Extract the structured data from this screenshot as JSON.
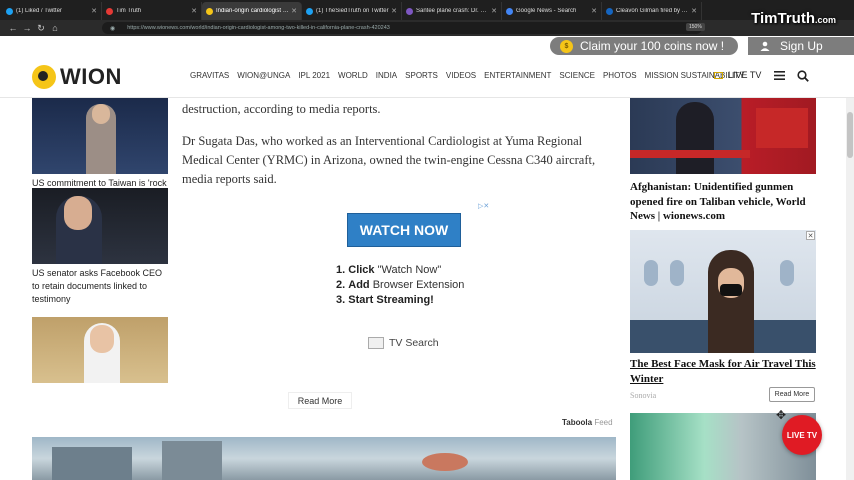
{
  "browser": {
    "tabs": [
      {
        "label": "(1) Liked / Twitter",
        "color": "#1da1f2",
        "active": false
      },
      {
        "label": "Tim Truth",
        "color": "#e53935",
        "active": false
      },
      {
        "label": "Indian-origin cardiologist amo",
        "color": "#f5c518",
        "active": true
      },
      {
        "label": "(1) TheSiedTruth on Twitter",
        "color": "#1da1f2",
        "active": false
      },
      {
        "label": "Santee plane crash: Dr. Sugata",
        "color": "#7e57c2",
        "active": false
      },
      {
        "label": "Google News - Search",
        "color": "#4285f4",
        "active": false
      },
      {
        "label": "Cleavon Gilman fired by Yuma",
        "color": "#1565c0",
        "active": false
      }
    ],
    "url": "https://www.wionews.com/world/indian-origin-cardiologist-among-two-killed-in-california-plane-crash-420243",
    "zoom": "150%"
  },
  "watermark": {
    "main": "TimTruth",
    "suffix": ".com"
  },
  "promo": {
    "coins_label": "Claim your 100 coins now !",
    "signup_label": "Sign Up"
  },
  "site": {
    "logo_text": "WION",
    "menu": [
      "GRAVITAS",
      "WION@UNGA",
      "IPL 2021",
      "WORLD",
      "INDIA",
      "SPORTS",
      "VIDEOS",
      "ENTERTAINMENT",
      "SCIENCE",
      "PHOTOS",
      "MISSION SUSTAINABILITY"
    ],
    "live_tv": "LIVE TV"
  },
  "left_sidebar": [
    {
      "caption": "US commitment to Taiwan is 'rock solid': Pentagon"
    },
    {
      "caption": "US senator asks Facebook CEO to retain documents linked to testimony"
    },
    {
      "caption": ""
    }
  ],
  "article": {
    "p1": "destruction, according to media reports.",
    "p2": "Dr Sugata Das, who worked as an Interventional Cardiologist at Yuma Regional Medical Center (YRMC) in Arizona, owned the twin-engine Cessna C340 aircraft, media reports said."
  },
  "ad": {
    "button": "WATCH NOW",
    "steps": [
      {
        "num": "1.",
        "bold": "Click",
        "rest": " \"Watch Now\""
      },
      {
        "num": "2.",
        "bold": "Add",
        "rest": " Browser Extension"
      },
      {
        "num": "3.",
        "bold": "Start Streaming!",
        "rest": ""
      }
    ],
    "brand": "TV Search"
  },
  "read_more": "Read More",
  "taboola": {
    "brand": "Taboola",
    "feed": "Feed"
  },
  "right_column": {
    "card1_caption": "Afghanistan: Unidentified gunmen opened fire on Taliban vehicle, World News | wionews.com",
    "card2_caption": "The Best Face Mask for Air Travel This Winter",
    "card2_sponsor": "Sonovia",
    "card2_read_more": "Read More"
  },
  "live_badge": "LIVE TV"
}
